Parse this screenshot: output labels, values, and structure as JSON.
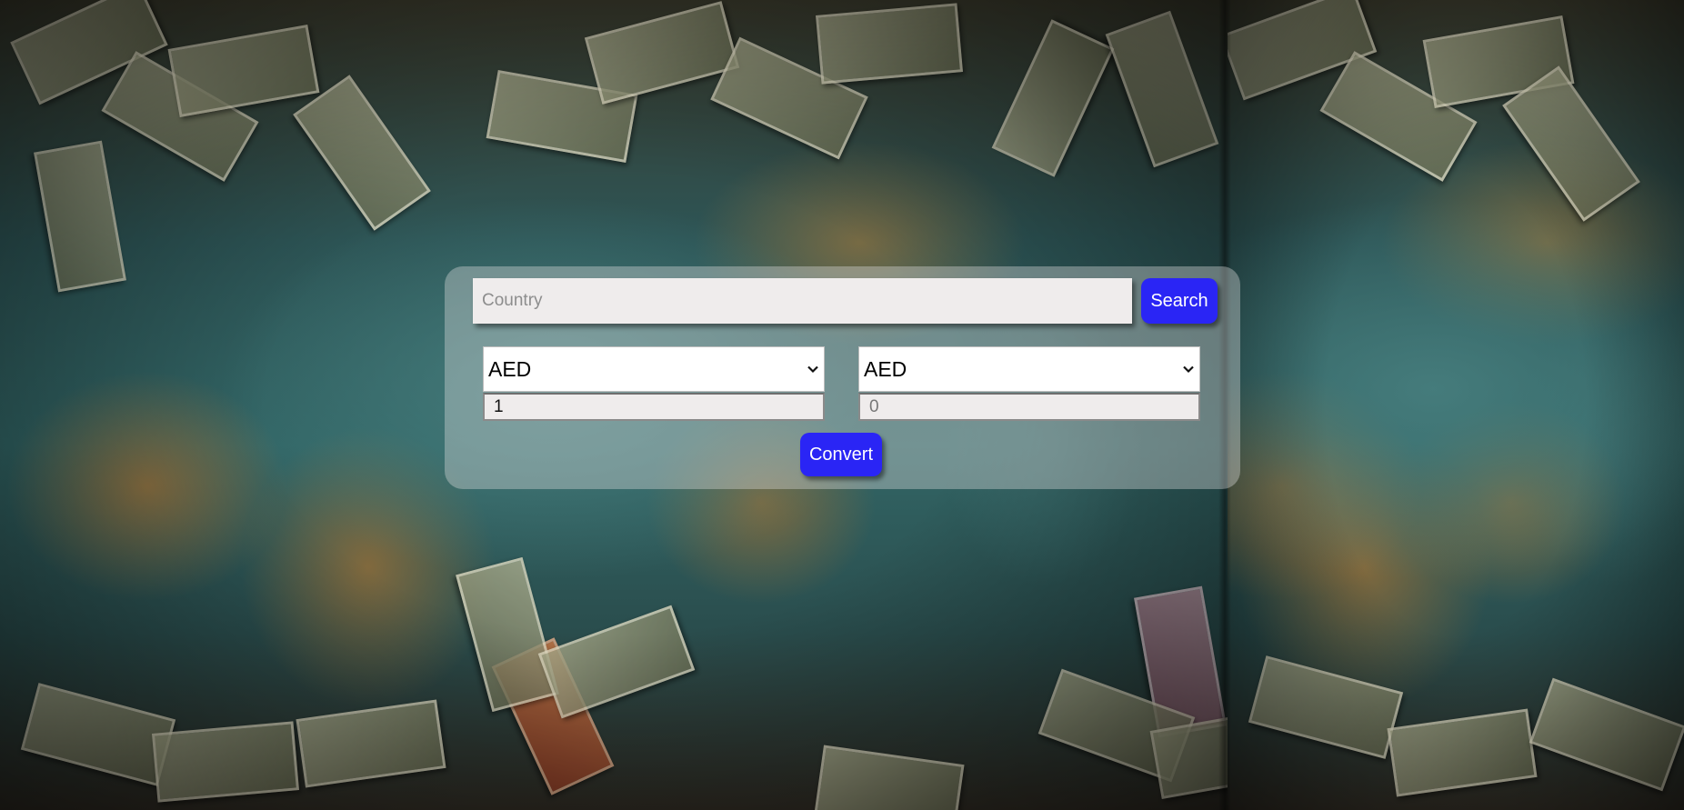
{
  "search": {
    "placeholder": "Country",
    "value": "",
    "button_label": "Search"
  },
  "converter": {
    "from_currency": "AED",
    "to_currency": "AED",
    "from_amount": "1",
    "to_amount": "0",
    "convert_label": "Convert"
  },
  "colors": {
    "button": "#2a25f5",
    "panel": "rgba(220,220,220,0.38)"
  },
  "icons": {
    "select_arrow": "chevron-down-icon"
  }
}
